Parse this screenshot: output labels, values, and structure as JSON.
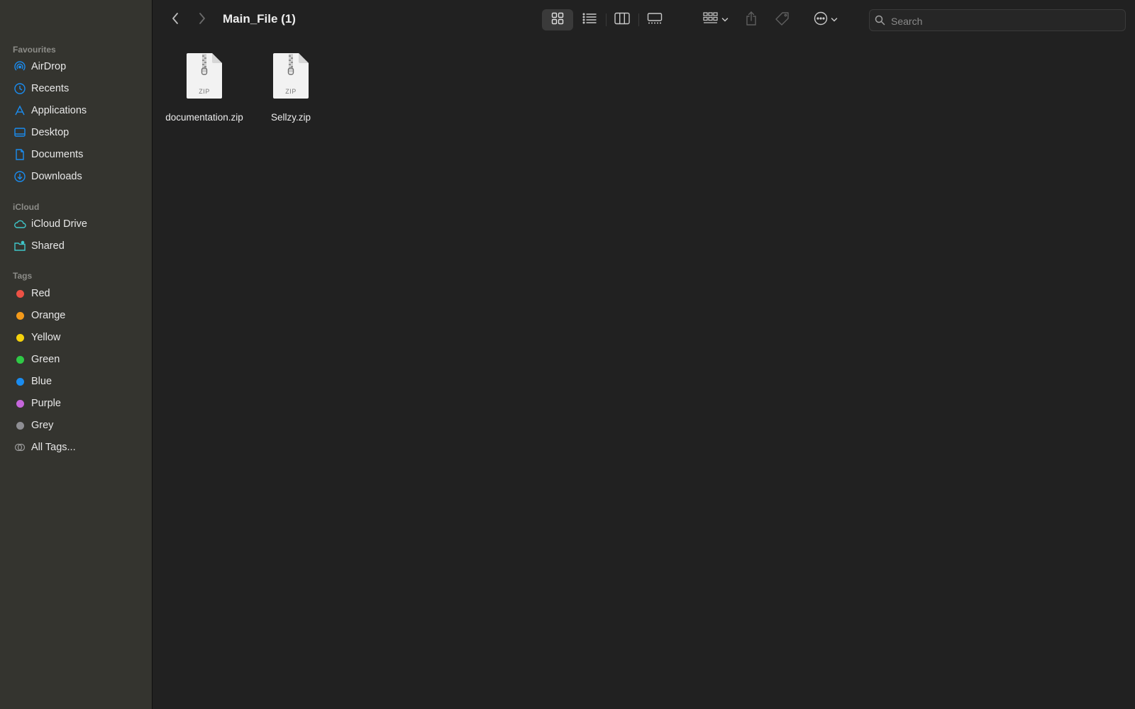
{
  "window": {
    "title": "Main_File (1)"
  },
  "sidebar": {
    "favourites_header": "Favourites",
    "favourites": [
      {
        "label": "AirDrop",
        "icon": "airdrop-icon"
      },
      {
        "label": "Recents",
        "icon": "clock-icon"
      },
      {
        "label": "Applications",
        "icon": "applications-icon"
      },
      {
        "label": "Desktop",
        "icon": "desktop-icon"
      },
      {
        "label": "Documents",
        "icon": "document-icon"
      },
      {
        "label": "Downloads",
        "icon": "download-icon"
      }
    ],
    "icloud_header": "iCloud",
    "icloud": [
      {
        "label": "iCloud Drive",
        "icon": "cloud-icon"
      },
      {
        "label": "Shared",
        "icon": "shared-folder-icon"
      }
    ],
    "tags_header": "Tags",
    "tags": [
      {
        "label": "Red",
        "color": "#ec5145"
      },
      {
        "label": "Orange",
        "color": "#f39a1a"
      },
      {
        "label": "Yellow",
        "color": "#f5d20c"
      },
      {
        "label": "Green",
        "color": "#2fc946"
      },
      {
        "label": "Blue",
        "color": "#1a8cf0"
      },
      {
        "label": "Purple",
        "color": "#c566db"
      },
      {
        "label": "Grey",
        "color": "#8e8e93"
      }
    ],
    "all_tags": "All Tags..."
  },
  "search": {
    "placeholder": "Search"
  },
  "files": [
    {
      "name": "documentation.zip",
      "badge": "ZIP"
    },
    {
      "name": "Sellzy.zip",
      "badge": "ZIP"
    }
  ],
  "colors": {
    "accent": "#1a8cf0",
    "icloud_accent": "#3fc6c9"
  }
}
